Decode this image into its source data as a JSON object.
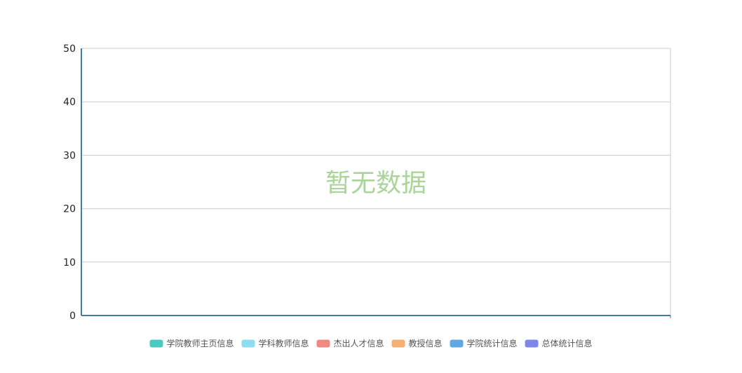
{
  "chart_data": {
    "type": "bar",
    "title": "",
    "xlabel": "",
    "ylabel": "",
    "ylim": [
      0,
      50
    ],
    "yticks": [
      "0",
      "10",
      "20",
      "30",
      "40",
      "50"
    ],
    "grid": true,
    "legend_position": "bottom",
    "empty_text": "暂无数据",
    "categories": [],
    "series": [
      {
        "name": "学院教师主页信息",
        "color": "#4cc9c0",
        "values": []
      },
      {
        "name": "学科教师信息",
        "color": "#8fdcf0",
        "values": []
      },
      {
        "name": "杰出人才信息",
        "color": "#ef8a80",
        "values": []
      },
      {
        "name": "教授信息",
        "color": "#f5b173",
        "values": []
      },
      {
        "name": "学院统计信息",
        "color": "#5fa8e4",
        "values": []
      },
      {
        "name": "总体统计信息",
        "color": "#7e87e8",
        "values": []
      }
    ],
    "colors": {
      "axis": "#3e7fa0",
      "grid": "#cccccc",
      "empty_text": "#a9d49a"
    }
  }
}
